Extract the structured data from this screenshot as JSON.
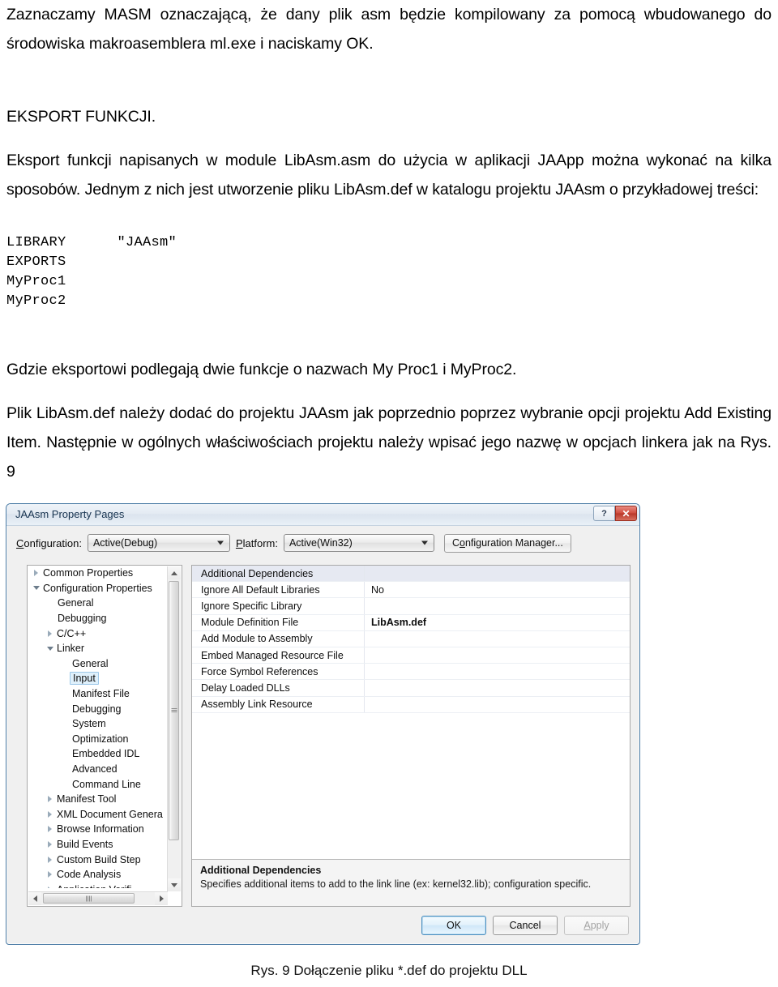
{
  "document": {
    "paragraphs": [
      "Zaznaczamy MASM oznaczającą, że dany plik asm będzie kompilowany za pomocą wbudowanego do środowiska makroasemblera ml.exe i naciskamy OK.",
      "EKSPORT FUNKCJI.",
      "Eksport  funkcji napisanych w module LibAsm.asm do użycia w aplikacji JAApp można wykonać na kilka sposobów. Jednym z nich jest utworzenie pliku LibAsm.def w katalogu projektu  JAAsm o przykładowej treści:",
      "Gdzie eksportowi podlegają dwie funkcje o nazwach My Proc1 i MyProc2.",
      "Plik LibAsm.def należy dodać do projektu JAAsm jak poprzednio poprzez wybranie opcji projektu Add Existing Item.  Następnie w ogólnych właściwościach projektu należy wpisać jego nazwę w opcjach linkera jak na Rys. 9"
    ],
    "code_block": "LIBRARY      \"JAAsm\"\nEXPORTS\nMyProc1\nMyProc2",
    "figure_caption": "Rys. 9 Dołączenie pliku *.def do projektu DLL"
  },
  "dialog": {
    "title": "JAAsm Property Pages",
    "titlebar": {
      "help_icon": "question-mark-icon",
      "close_icon": "close-x-icon",
      "help_glyph": "?",
      "close_glyph": "✕"
    },
    "configuration": {
      "label": "Configuration:",
      "label_prefix": "C",
      "label_rest": "onfiguration:",
      "value": "Active(Debug)"
    },
    "platform": {
      "label": "Platform:",
      "label_prefix": "P",
      "label_rest": "latform:",
      "value": "Active(Win32)"
    },
    "config_manager_button": {
      "prefix": "C",
      "underlined": "o",
      "rest": "nfiguration Manager..."
    },
    "tree": [
      {
        "label": "Common Properties",
        "indent": 0,
        "twisty": "closed",
        "selected": false
      },
      {
        "label": "Configuration Properties",
        "indent": 0,
        "twisty": "open",
        "selected": false
      },
      {
        "label": "General",
        "indent": 1,
        "twisty": "none",
        "selected": false
      },
      {
        "label": "Debugging",
        "indent": 1,
        "twisty": "none",
        "selected": false
      },
      {
        "label": "C/C++",
        "indent": 2,
        "twisty": "closed",
        "selected": false
      },
      {
        "label": "Linker",
        "indent": 2,
        "twisty": "open",
        "selected": false
      },
      {
        "label": "General",
        "indent": 3,
        "twisty": "none",
        "selected": false
      },
      {
        "label": "Input",
        "indent": 3,
        "twisty": "none",
        "selected": true
      },
      {
        "label": "Manifest File",
        "indent": 3,
        "twisty": "none",
        "selected": false
      },
      {
        "label": "Debugging",
        "indent": 3,
        "twisty": "none",
        "selected": false
      },
      {
        "label": "System",
        "indent": 3,
        "twisty": "none",
        "selected": false
      },
      {
        "label": "Optimization",
        "indent": 3,
        "twisty": "none",
        "selected": false
      },
      {
        "label": "Embedded IDL",
        "indent": 3,
        "twisty": "none",
        "selected": false
      },
      {
        "label": "Advanced",
        "indent": 3,
        "twisty": "none",
        "selected": false
      },
      {
        "label": "Command Line",
        "indent": 3,
        "twisty": "none",
        "selected": false
      },
      {
        "label": "Manifest Tool",
        "indent": 2,
        "twisty": "closed",
        "selected": false
      },
      {
        "label": "XML Document Genera",
        "indent": 2,
        "twisty": "closed",
        "selected": false
      },
      {
        "label": "Browse Information",
        "indent": 2,
        "twisty": "closed",
        "selected": false
      },
      {
        "label": "Build Events",
        "indent": 2,
        "twisty": "closed",
        "selected": false
      },
      {
        "label": "Custom Build Step",
        "indent": 2,
        "twisty": "closed",
        "selected": false
      },
      {
        "label": "Code Analysis",
        "indent": 2,
        "twisty": "closed",
        "selected": false
      },
      {
        "label": "Application Verifi",
        "indent": 2,
        "twisty": "closed",
        "selected": false
      }
    ],
    "properties": [
      {
        "name": "Additional Dependencies",
        "value": "",
        "highlighted": true,
        "bold": false
      },
      {
        "name": "Ignore All Default Libraries",
        "value": "No",
        "highlighted": false,
        "bold": false
      },
      {
        "name": "Ignore Specific Library",
        "value": "",
        "highlighted": false,
        "bold": false
      },
      {
        "name": "Module Definition File",
        "value": "LibAsm.def",
        "highlighted": false,
        "bold": true
      },
      {
        "name": "Add Module to Assembly",
        "value": "",
        "highlighted": false,
        "bold": false
      },
      {
        "name": "Embed Managed Resource File",
        "value": "",
        "highlighted": false,
        "bold": false
      },
      {
        "name": "Force Symbol References",
        "value": "",
        "highlighted": false,
        "bold": false
      },
      {
        "name": "Delay Loaded DLLs",
        "value": "",
        "highlighted": false,
        "bold": false
      },
      {
        "name": "Assembly Link Resource",
        "value": "",
        "highlighted": false,
        "bold": false
      }
    ],
    "description": {
      "title": "Additional Dependencies",
      "body": "Specifies additional items to add to the link line (ex: kernel32.lib); configuration specific."
    },
    "footer": {
      "ok": "OK",
      "cancel": "Cancel",
      "apply_prefix": "A",
      "apply_rest": "pply",
      "apply": "Apply"
    }
  },
  "colors": {
    "accent_blue": "#4a7ba5",
    "selection_blue": "#dff0fb",
    "row_highlight": "#e6e9f2",
    "close_red": "#cf4b3c"
  }
}
